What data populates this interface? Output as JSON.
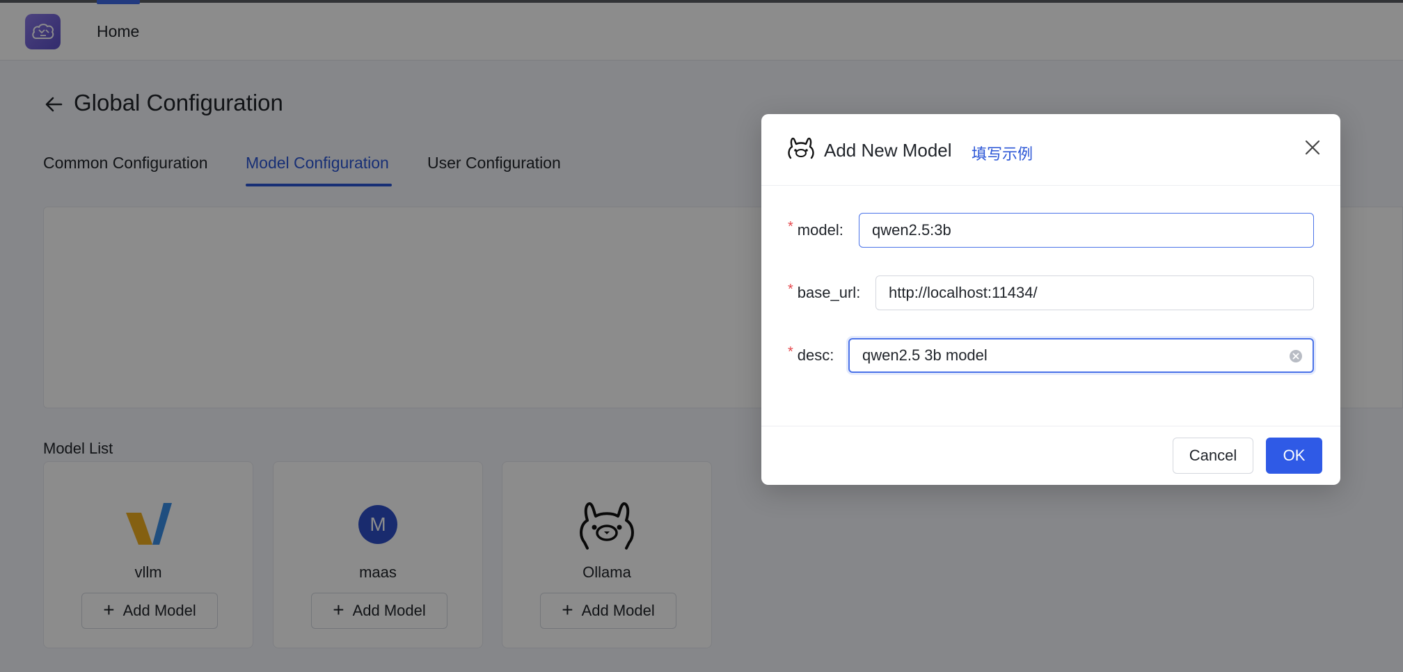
{
  "header": {
    "nav_home": "Home"
  },
  "page": {
    "title": "Global Configuration",
    "tabs": [
      {
        "label": "Common Configuration",
        "active": false
      },
      {
        "label": "Model Configuration",
        "active": true
      },
      {
        "label": "User Configuration",
        "active": false
      }
    ],
    "model_list_label": "Model List",
    "providers": [
      {
        "name": "vllm",
        "icon": "vllm-logo-icon",
        "add_label": "Add Model"
      },
      {
        "name": "maas",
        "icon": "maas-avatar-icon",
        "avatar_letter": "M",
        "add_label": "Add Model"
      },
      {
        "name": "Ollama",
        "icon": "ollama-logo-icon",
        "add_label": "Add Model"
      }
    ]
  },
  "modal": {
    "title": "Add New Model",
    "example_link": "填写示例",
    "fields": {
      "model": {
        "label": "model",
        "value": "qwen2.5:3b"
      },
      "base_url": {
        "label": "base_url",
        "value": "http://localhost:11434/"
      },
      "desc": {
        "label": "desc",
        "value": "qwen2.5 3b model"
      }
    },
    "cancel_label": "Cancel",
    "ok_label": "OK"
  },
  "colors": {
    "primary": "#2f5ae6",
    "required": "#e5484d",
    "link": "#2b56d6"
  }
}
